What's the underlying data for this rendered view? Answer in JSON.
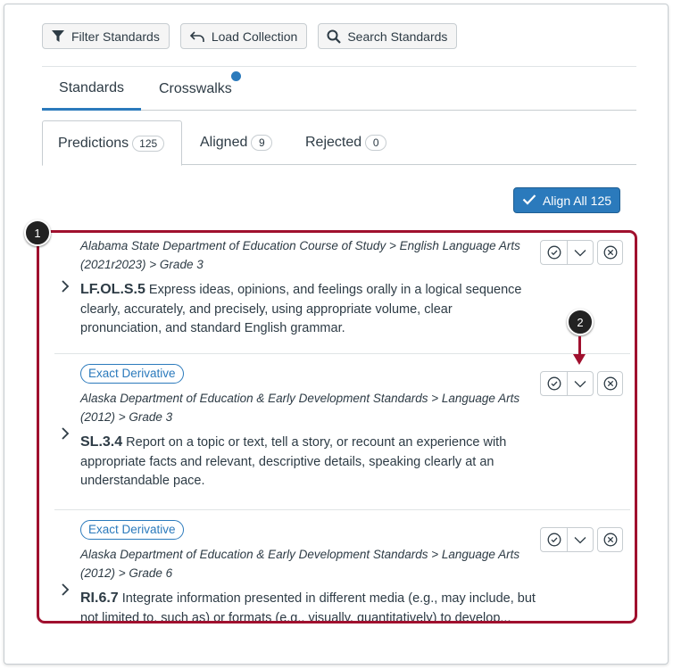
{
  "toolbar": {
    "filter_label": "Filter Standards",
    "load_label": "Load Collection",
    "search_label": "Search Standards"
  },
  "tabs": {
    "standards": "Standards",
    "crosswalks": "Crosswalks"
  },
  "subtabs": {
    "predictions": {
      "label": "Predictions",
      "count": "125"
    },
    "aligned": {
      "label": "Aligned",
      "count": "9"
    },
    "rejected": {
      "label": "Rejected",
      "count": "0"
    }
  },
  "align_all_label": "Align All 125",
  "callouts": {
    "one": "1",
    "two": "2"
  },
  "items": [
    {
      "tag": "",
      "path": "Alabama State Department of Education Course of Study > English Language Arts (2021r2023) > Grade 3",
      "code": "LF.OL.S.5",
      "description": " Express ideas, opinions, and feelings orally in a logical sequence clearly, accurately, and precisely, using appropriate volume, clear pronunciation, and standard English grammar."
    },
    {
      "tag": "Exact Derivative",
      "path": "Alaska Department of Education & Early Development Standards > Language Arts (2012) > Grade 3",
      "code": "SL.3.4",
      "description": " Report on a topic or text, tell a story, or recount an experience with appropriate facts and relevant, descriptive details, speaking clearly at an understandable pace."
    },
    {
      "tag": "Exact Derivative",
      "path": "Alaska Department of Education & Early Development Standards > Language Arts (2012) > Grade 6",
      "code": "RI.6.7",
      "description": " Integrate information presented in different media (e.g., may include, but not limited to, such as) or formats (e.g., visually, quantitatively) to develop..."
    }
  ],
  "colors": {
    "accent": "#2b7abc",
    "callout_border": "#a0102e"
  },
  "icons": {
    "filter": "filter-icon",
    "load": "undo-arrow-icon",
    "search": "search-icon",
    "align": "checkmark-icon",
    "approve": "check-circle-icon",
    "menu": "chevron-down-icon",
    "reject": "x-circle-icon",
    "expand": "chevron-right-icon"
  }
}
